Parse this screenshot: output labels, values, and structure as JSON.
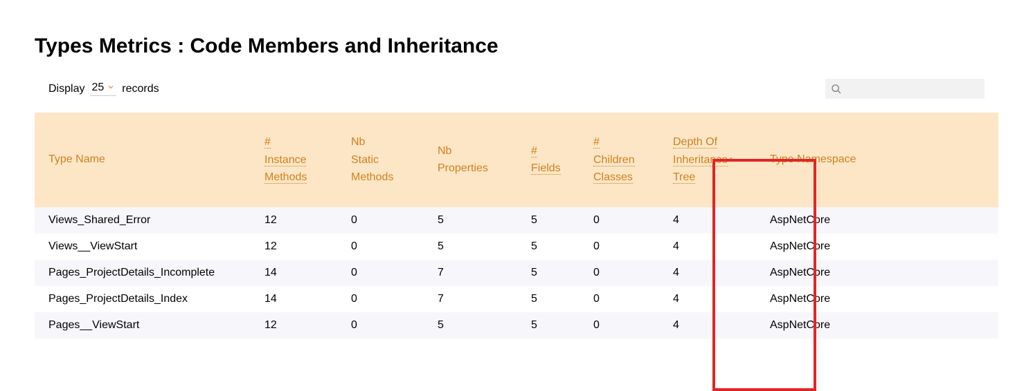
{
  "title": "Types Metrics : Code Members and Inheritance",
  "controls": {
    "display_label": "Display",
    "page_size": "25",
    "records_label": "records",
    "search_placeholder": ""
  },
  "table": {
    "headers": {
      "typename": "Type Name",
      "instance_l1": "#",
      "instance_l2": "Instance",
      "instance_l3": "Methods",
      "static_l1": "Nb",
      "static_l2": "Static",
      "static_l3": "Methods",
      "props_l1": "Nb",
      "props_l2": "Properties",
      "fields_l1": "#",
      "fields_l2": "Fields",
      "children_l1": "#",
      "children_l2": "Children",
      "children_l3": "Classes",
      "depth_l1": "Depth Of",
      "depth_l2": "Inheritance",
      "depth_l3": "Tree",
      "sort_arrow": "^",
      "namespace": "Type Namespace"
    },
    "rows": [
      {
        "typename": "Views_Shared_Error",
        "instance": "12",
        "static": "0",
        "props": "5",
        "fields": "5",
        "children": "0",
        "depth": "4",
        "namespace": "AspNetCore"
      },
      {
        "typename": "Views__ViewStart",
        "instance": "12",
        "static": "0",
        "props": "5",
        "fields": "5",
        "children": "0",
        "depth": "4",
        "namespace": "AspNetCore"
      },
      {
        "typename": "Pages_ProjectDetails_Incomplete",
        "instance": "14",
        "static": "0",
        "props": "7",
        "fields": "5",
        "children": "0",
        "depth": "4",
        "namespace": "AspNetCore"
      },
      {
        "typename": "Pages_ProjectDetails_Index",
        "instance": "14",
        "static": "0",
        "props": "7",
        "fields": "5",
        "children": "0",
        "depth": "4",
        "namespace": "AspNetCore"
      },
      {
        "typename": "Pages__ViewStart",
        "instance": "12",
        "static": "0",
        "props": "5",
        "fields": "5",
        "children": "0",
        "depth": "4",
        "namespace": "AspNetCore"
      }
    ]
  }
}
